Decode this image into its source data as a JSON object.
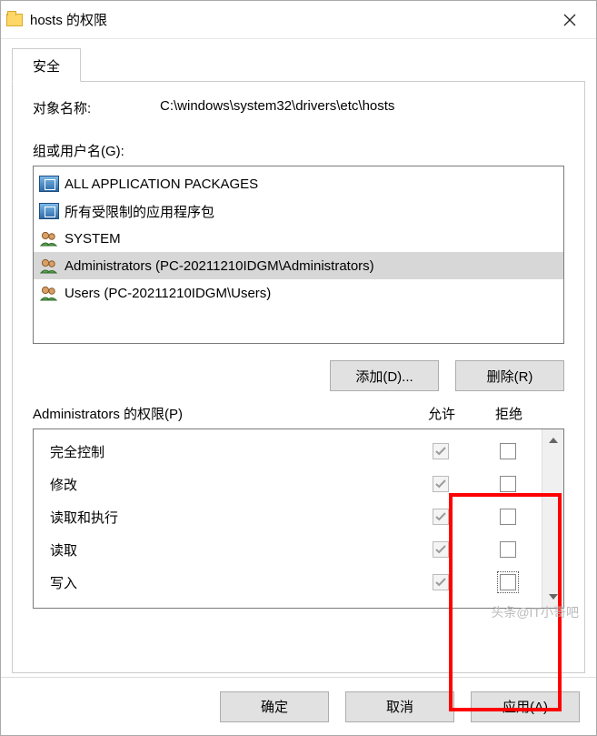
{
  "title": "hosts 的权限",
  "tab": {
    "label": "安全"
  },
  "object": {
    "label": "对象名称:",
    "path": "C:\\windows\\system32\\drivers\\etc\\hosts"
  },
  "group": {
    "label": "组或用户名(G):",
    "items": [
      {
        "name": "ALL APPLICATION PACKAGES",
        "icon": "pkg",
        "selected": false
      },
      {
        "name": "所有受限制的应用程序包",
        "icon": "pkg",
        "selected": false
      },
      {
        "name": "SYSTEM",
        "icon": "grp",
        "selected": false
      },
      {
        "name": "Administrators (PC-20211210IDGM\\Administrators)",
        "icon": "grp",
        "selected": true
      },
      {
        "name": "Users (PC-20211210IDGM\\Users)",
        "icon": "grp",
        "selected": false
      }
    ]
  },
  "buttons": {
    "add": "添加(D)...",
    "remove": "删除(R)",
    "ok": "确定",
    "cancel": "取消",
    "apply": "应用(A)"
  },
  "perm": {
    "title": "Administrators 的权限(P)",
    "allow": "允许",
    "deny": "拒绝",
    "rows": [
      {
        "name": "完全控制",
        "allow": true,
        "deny": false
      },
      {
        "name": "修改",
        "allow": true,
        "deny": false
      },
      {
        "name": "读取和执行",
        "allow": true,
        "deny": false
      },
      {
        "name": "读取",
        "allow": true,
        "deny": false
      },
      {
        "name": "写入",
        "allow": true,
        "deny": false,
        "focused": true
      }
    ]
  },
  "watermark": "头条@IT小哥吧"
}
